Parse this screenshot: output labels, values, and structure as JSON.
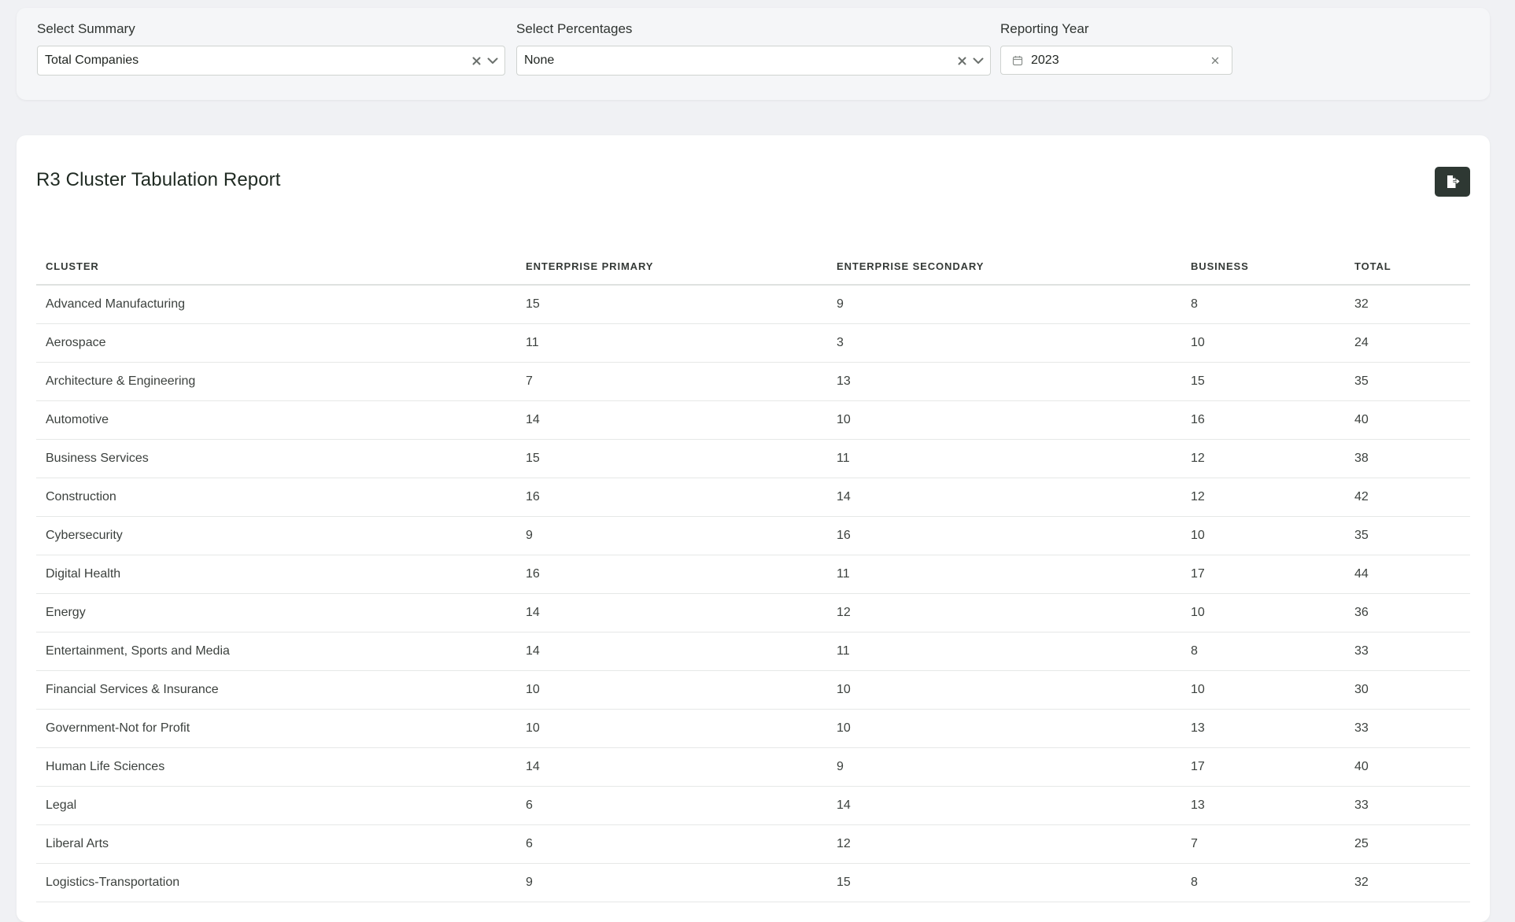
{
  "filters": {
    "summary": {
      "label": "Select Summary",
      "value": "Total Companies"
    },
    "percentages": {
      "label": "Select Percentages",
      "value": "None"
    },
    "year": {
      "label": "Reporting Year",
      "value": "2023"
    }
  },
  "report": {
    "title": "R3 Cluster Tabulation Report",
    "export_icon": "file-export-icon",
    "columns": [
      "CLUSTER",
      "ENTERPRISE PRIMARY",
      "ENTERPRISE SECONDARY",
      "BUSINESS",
      "TOTAL"
    ],
    "rows": [
      [
        "Advanced Manufacturing",
        "15",
        "9",
        "8",
        "32"
      ],
      [
        "Aerospace",
        "11",
        "3",
        "10",
        "24"
      ],
      [
        "Architecture & Engineering",
        "7",
        "13",
        "15",
        "35"
      ],
      [
        "Automotive",
        "14",
        "10",
        "16",
        "40"
      ],
      [
        "Business Services",
        "15",
        "11",
        "12",
        "38"
      ],
      [
        "Construction",
        "16",
        "14",
        "12",
        "42"
      ],
      [
        "Cybersecurity",
        "9",
        "16",
        "10",
        "35"
      ],
      [
        "Digital Health",
        "16",
        "11",
        "17",
        "44"
      ],
      [
        "Energy",
        "14",
        "12",
        "10",
        "36"
      ],
      [
        "Entertainment, Sports and Media",
        "14",
        "11",
        "8",
        "33"
      ],
      [
        "Financial Services & Insurance",
        "10",
        "10",
        "10",
        "30"
      ],
      [
        "Government-Not for Profit",
        "10",
        "10",
        "13",
        "33"
      ],
      [
        "Human Life Sciences",
        "14",
        "9",
        "17",
        "40"
      ],
      [
        "Legal",
        "6",
        "14",
        "13",
        "33"
      ],
      [
        "Liberal Arts",
        "6",
        "12",
        "7",
        "25"
      ],
      [
        "Logistics-Transportation",
        "9",
        "15",
        "8",
        "32"
      ]
    ]
  },
  "colors": {
    "page_background": "#f0f1f4",
    "panel_background": "#f5f6f8",
    "card_background": "#ffffff",
    "export_button": "#2e3833",
    "title_text": "#1f2a22"
  }
}
